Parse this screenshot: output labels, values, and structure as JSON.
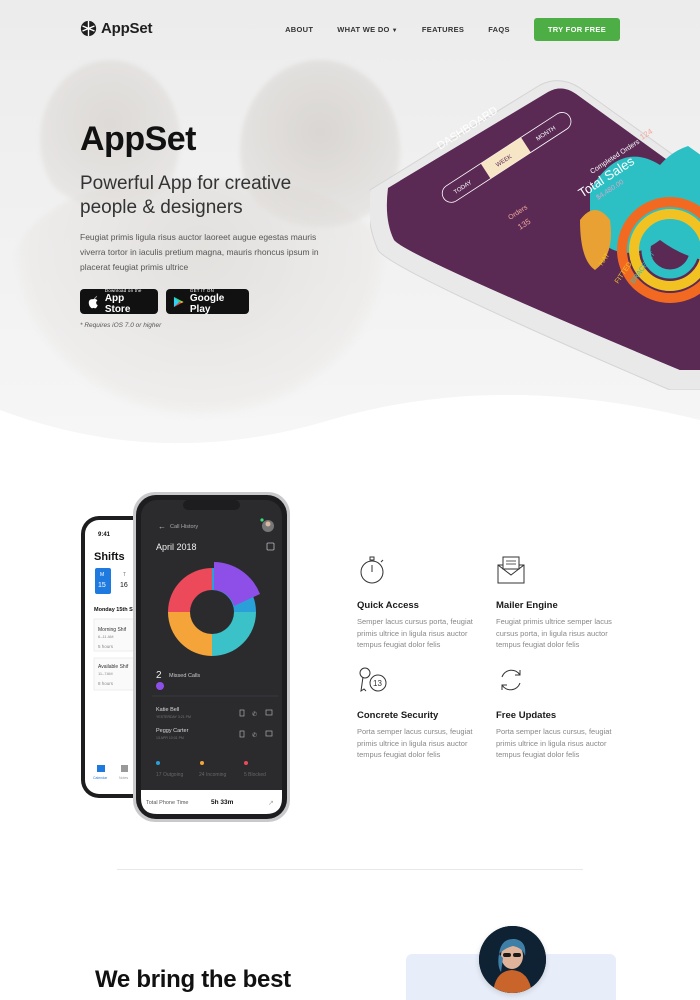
{
  "nav": {
    "brand": "AppSet",
    "links": [
      "ABOUT",
      "WHAT WE DO",
      "FEATURES",
      "FAQS"
    ],
    "cta": "TRY FOR FREE"
  },
  "hero": {
    "title": "AppSet",
    "subtitle": "Powerful App for creative people & designers",
    "description": "Feugiat primis ligula risus auctor laoreet augue egestas mauris viverra tortor in iaculis pretium magna, mauris rhoncus ipsum in placerat feugiat primis ultrice",
    "app_store": {
      "small": "Download on the",
      "big": "App Store"
    },
    "google_play": {
      "small": "GET IT ON",
      "big": "Google Play"
    },
    "note": "* Requires iOS 7.0 or higher",
    "phone": {
      "tabs": [
        "TODAY",
        "WEEK",
        "MONTH"
      ],
      "header": "DASHBOARD",
      "orders_label": "Orders",
      "orders_value": "135",
      "completed_label": "Completed Orders",
      "completed_value": "124",
      "sales_label": "Total Sales",
      "sales_value": "$4,480.00",
      "ring_labels": [
        "HAT",
        "FITTED CAP",
        "BRACELET"
      ]
    }
  },
  "phones": {
    "back": {
      "time": "9:41",
      "title": "Shifts",
      "day1": "M",
      "date1": "15",
      "day2": "T",
      "date2": "16",
      "heading": "Monday 15th S",
      "shift1": "Morning Shif",
      "shift1_time": "6–11 AM",
      "shift1_hours": "5 hours",
      "shift2": "Available Shif",
      "shift2_time": "11–7AM",
      "shift2_hours": "8 hours",
      "tab1": "Calendar",
      "tab2": "Notes"
    },
    "front": {
      "back_label": "Call History",
      "month": "April 2018",
      "missed_count": "2",
      "missed_label": "Missed Calls",
      "calls": [
        {
          "name": "Katie Bell",
          "time": "YESTERDAY 3:21 PM"
        },
        {
          "name": "Peggy Carter",
          "time": "13 APR 10:01 PM"
        }
      ],
      "stats": [
        "17 Outgoing",
        "24 Incoming",
        "5 Blocked"
      ],
      "total_label": "Total Phone Time",
      "total_value": "5h 33m"
    }
  },
  "features": [
    {
      "title": "Quick Access",
      "text": "Semper lacus cursus porta, feugiat primis ultrice in ligula risus auctor tempus feugiat dolor felis",
      "icon": "stopwatch-icon"
    },
    {
      "title": "Mailer Engine",
      "text": "Feugiat primis ultrice semper lacus cursus porta, in ligula risus auctor tempus feugiat dolor felis",
      "icon": "envelope-icon"
    },
    {
      "title": "Concrete Security",
      "text": "Porta semper lacus cursus, feugiat primis ultrice in ligula risus auctor tempus feugiat dolor felis",
      "icon": "keys-icon"
    },
    {
      "title": "Free Updates",
      "text": "Porta semper lacus cursus, feugiat primis ultrice in ligula risus auctor tempus feugiat dolor felis",
      "icon": "refresh-icon"
    }
  ],
  "bottom": {
    "heading": "We bring the best"
  },
  "colors": {
    "accent_green": "#4dae46",
    "phone_purple": "#5a2a55",
    "dark_phone": "#2b2b2e"
  }
}
